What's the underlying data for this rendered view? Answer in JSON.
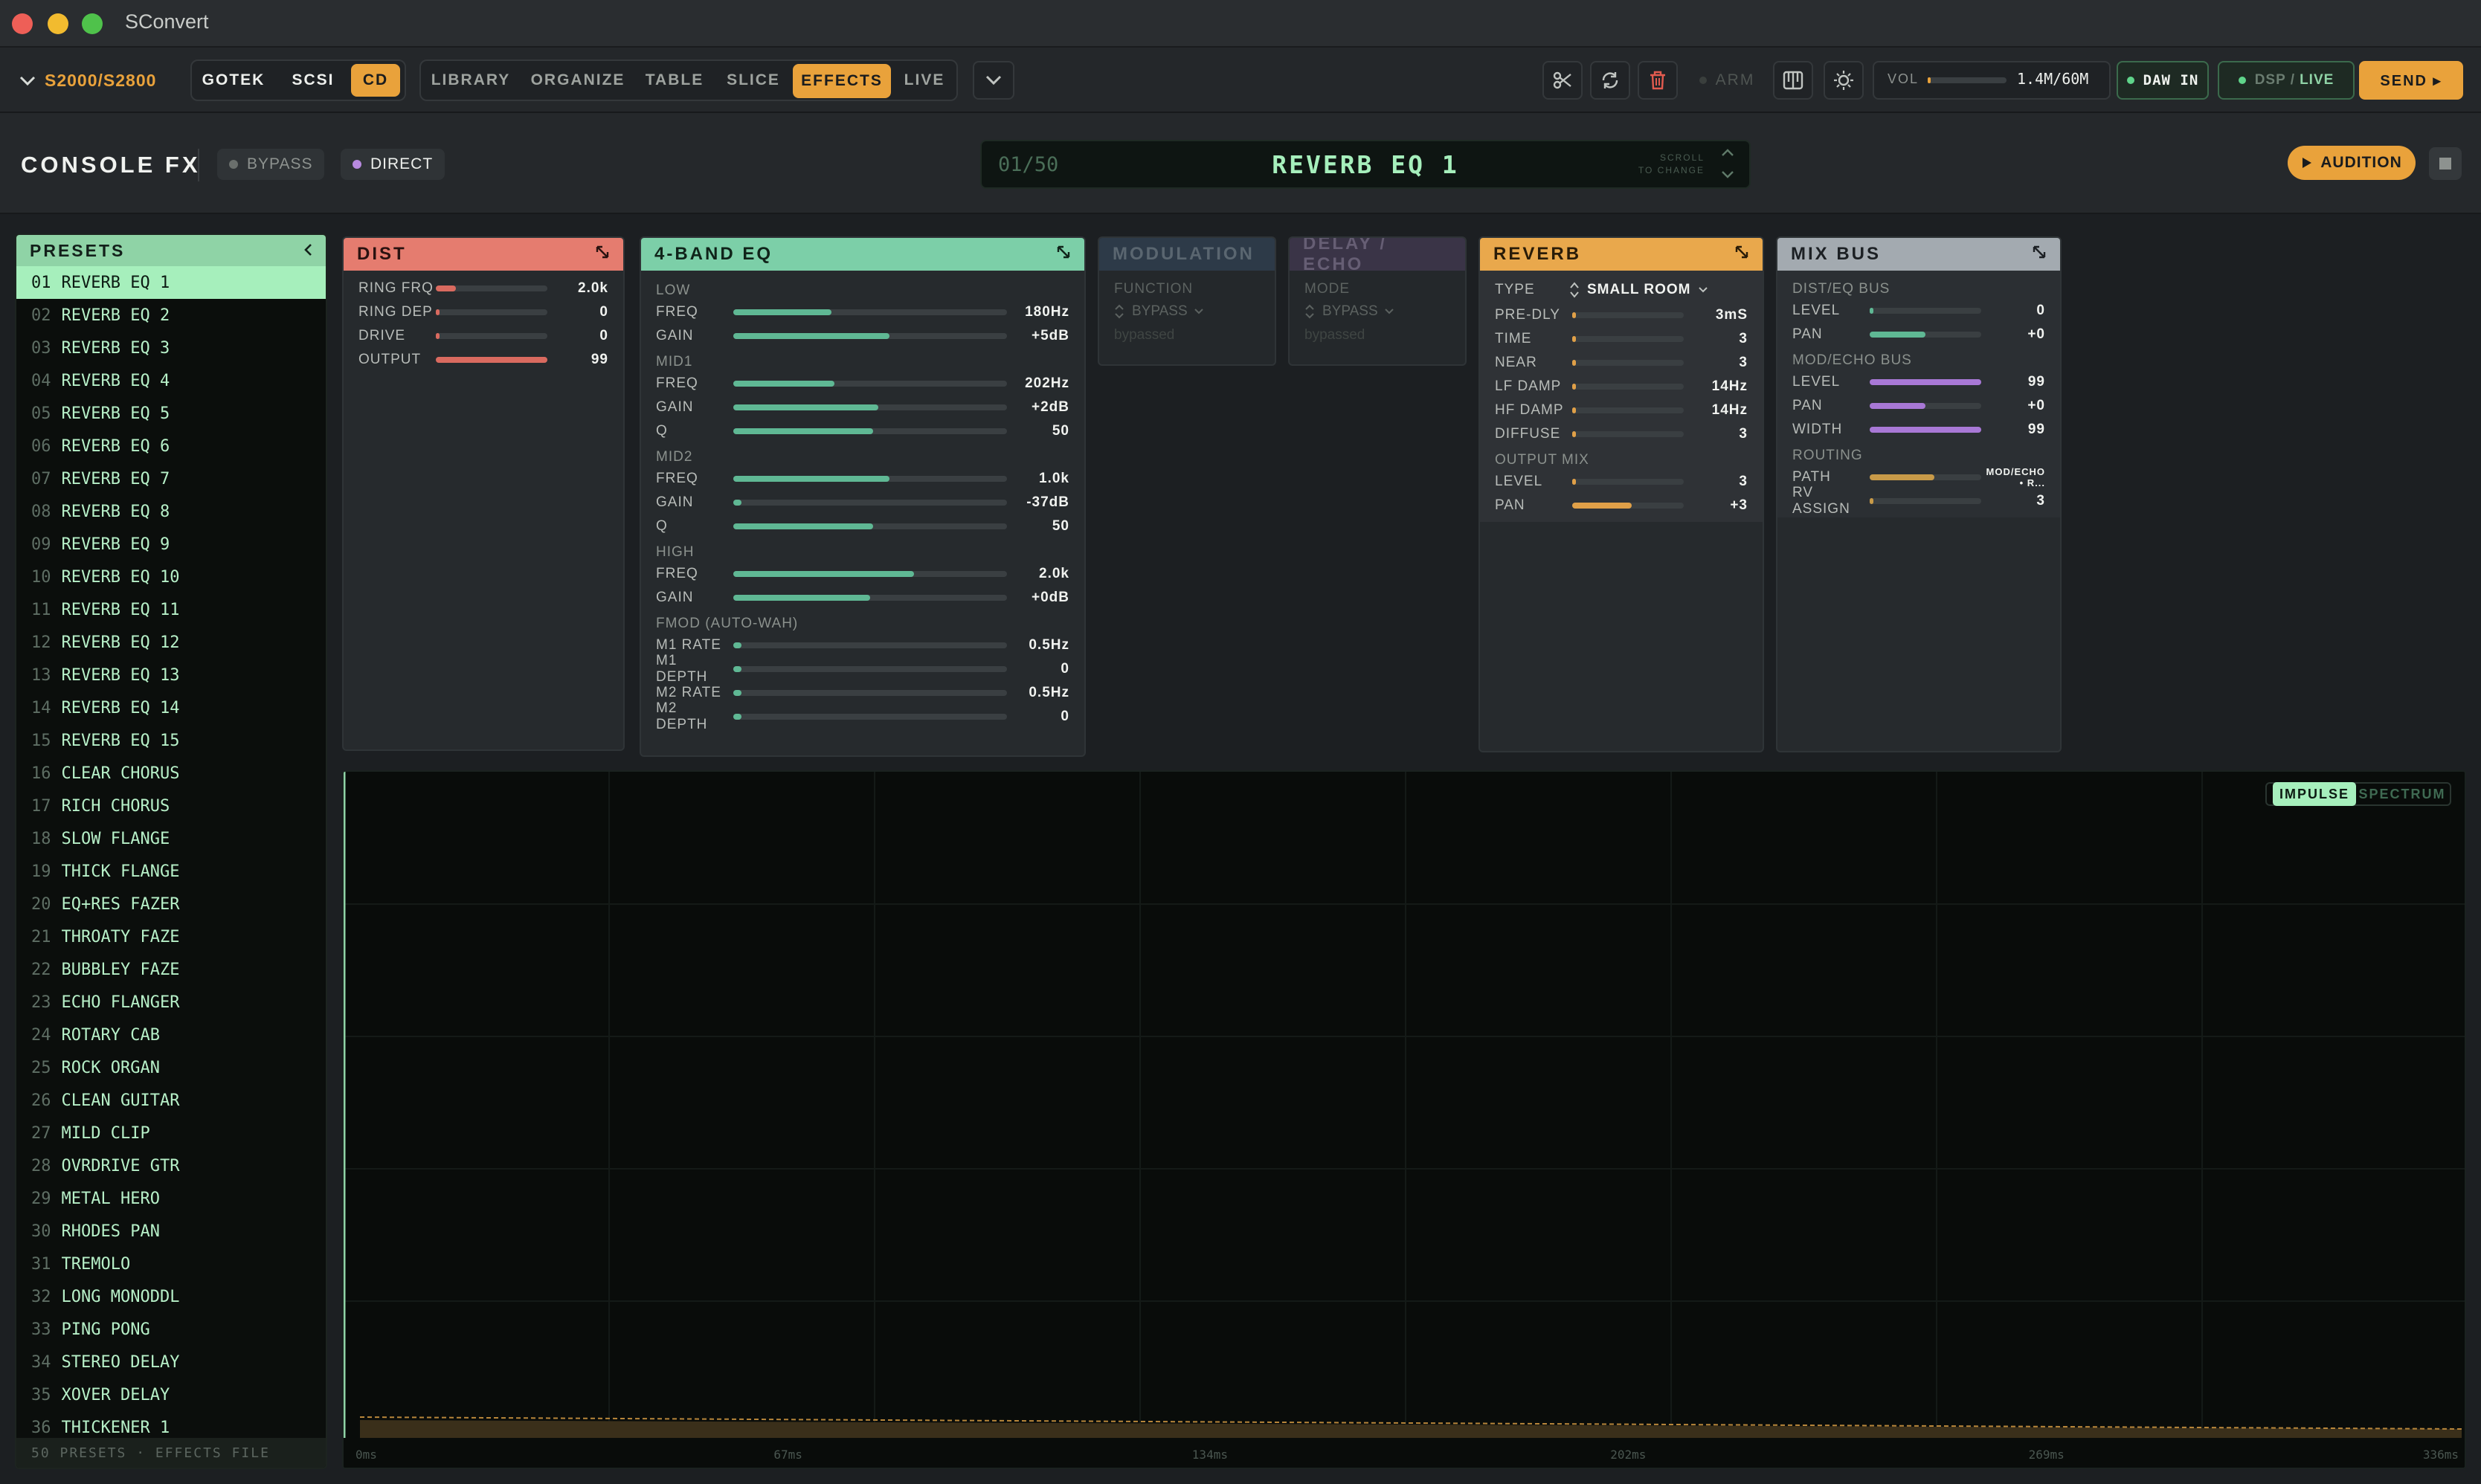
{
  "window": {
    "title": "SConvert"
  },
  "toolbar": {
    "device": "S2000/S2800",
    "media": [
      "GOTEK",
      "SCSI",
      "CD"
    ],
    "media_selected": "CD",
    "tabs": [
      "LIBRARY",
      "ORGANIZE",
      "TABLE",
      "SLICE",
      "EFFECTS",
      "LIVE"
    ],
    "tab_selected": "EFFECTS",
    "arm": "ARM",
    "vol_label": "VOL",
    "vol_level": 0.03,
    "memory": "1.4M/60M",
    "daw_in": "DAW IN",
    "dsp_label": "DSP",
    "live_label": "LIVE",
    "send": "SEND ▸"
  },
  "console": {
    "title": "CONSOLE FX",
    "bypass": "BYPASS",
    "direct": "DIRECT",
    "counter": "01/50",
    "preset_name": "REVERB EQ 1",
    "scroll_hint_1": "SCROLL",
    "scroll_hint_2": "TO CHANGE",
    "audition": "AUDITION"
  },
  "presets": {
    "title": "PRESETS",
    "footer": "50 PRESETS · EFFECTS FILE",
    "selected": 0,
    "items": [
      {
        "n": "01",
        "name": "REVERB EQ 1"
      },
      {
        "n": "02",
        "name": "REVERB EQ 2"
      },
      {
        "n": "03",
        "name": "REVERB EQ 3"
      },
      {
        "n": "04",
        "name": "REVERB EQ 4"
      },
      {
        "n": "05",
        "name": "REVERB EQ 5"
      },
      {
        "n": "06",
        "name": "REVERB EQ 6"
      },
      {
        "n": "07",
        "name": "REVERB EQ 7"
      },
      {
        "n": "08",
        "name": "REVERB EQ 8"
      },
      {
        "n": "09",
        "name": "REVERB EQ 9"
      },
      {
        "n": "10",
        "name": "REVERB EQ 10"
      },
      {
        "n": "11",
        "name": "REVERB EQ 11"
      },
      {
        "n": "12",
        "name": "REVERB EQ 12"
      },
      {
        "n": "13",
        "name": "REVERB EQ 13"
      },
      {
        "n": "14",
        "name": "REVERB EQ 14"
      },
      {
        "n": "15",
        "name": "REVERB EQ 15"
      },
      {
        "n": "16",
        "name": "CLEAR CHORUS"
      },
      {
        "n": "17",
        "name": "RICH CHORUS"
      },
      {
        "n": "18",
        "name": "SLOW FLANGE"
      },
      {
        "n": "19",
        "name": "THICK FLANGE"
      },
      {
        "n": "20",
        "name": "EQ+RES FAZER"
      },
      {
        "n": "21",
        "name": "THROATY FAZE"
      },
      {
        "n": "22",
        "name": "BUBBLEY FAZE"
      },
      {
        "n": "23",
        "name": "ECHO FLANGER"
      },
      {
        "n": "24",
        "name": "ROTARY CAB"
      },
      {
        "n": "25",
        "name": "ROCK ORGAN"
      },
      {
        "n": "26",
        "name": "CLEAN GUITAR"
      },
      {
        "n": "27",
        "name": "MILD CLIP"
      },
      {
        "n": "28",
        "name": "OVRDRIVE GTR"
      },
      {
        "n": "29",
        "name": "METAL HERO"
      },
      {
        "n": "30",
        "name": "RHODES PAN"
      },
      {
        "n": "31",
        "name": "TREMOLO"
      },
      {
        "n": "32",
        "name": "LONG MONODDL"
      },
      {
        "n": "33",
        "name": "PING PONG"
      },
      {
        "n": "34",
        "name": "STEREO DELAY"
      },
      {
        "n": "35",
        "name": "XOVER DELAY"
      },
      {
        "n": "36",
        "name": "THICKENER 1"
      }
    ]
  },
  "dist": {
    "title": "DIST",
    "params": [
      {
        "label": "RING FRQ",
        "value": "2.0k",
        "level": 0.18
      },
      {
        "label": "RING DEP",
        "value": "0",
        "level": 0.03
      },
      {
        "label": "DRIVE",
        "value": "0",
        "level": 0.03
      },
      {
        "label": "OUTPUT",
        "value": "99",
        "level": 1.0
      }
    ]
  },
  "eq": {
    "title": "4-BAND EQ",
    "sections": [
      {
        "name": "LOW",
        "params": [
          {
            "label": "FREQ",
            "value": "180Hz",
            "level": 0.36
          },
          {
            "label": "GAIN",
            "value": "+5dB",
            "level": 0.57
          }
        ]
      },
      {
        "name": "MID1",
        "params": [
          {
            "label": "FREQ",
            "value": "202Hz",
            "level": 0.37
          },
          {
            "label": "GAIN",
            "value": "+2dB",
            "level": 0.53
          },
          {
            "label": "Q",
            "value": "50",
            "level": 0.51
          }
        ]
      },
      {
        "name": "MID2",
        "params": [
          {
            "label": "FREQ",
            "value": "1.0k",
            "level": 0.57
          },
          {
            "label": "GAIN",
            "value": "-37dB",
            "level": 0.02
          },
          {
            "label": "Q",
            "value": "50",
            "level": 0.51
          }
        ]
      },
      {
        "name": "HIGH",
        "params": [
          {
            "label": "FREQ",
            "value": "2.0k",
            "level": 0.66
          },
          {
            "label": "GAIN",
            "value": "+0dB",
            "level": 0.5
          }
        ]
      },
      {
        "name": "FMOD (AUTO-WAH)",
        "params": [
          {
            "label": "M1 RATE",
            "value": "0.5Hz",
            "level": 0.02
          },
          {
            "label": "M1 DEPTH",
            "value": "0",
            "level": 0.02
          },
          {
            "label": "M2 RATE",
            "value": "0.5Hz",
            "level": 0.02
          },
          {
            "label": "M2 DEPTH",
            "value": "0",
            "level": 0.02
          }
        ]
      }
    ]
  },
  "modulation": {
    "title": "MODULATION",
    "field": "FUNCTION",
    "value": "BYPASS",
    "note": "bypassed"
  },
  "delay": {
    "title": "DELAY / ECHO",
    "field": "MODE",
    "value": "BYPASS",
    "note": "bypassed"
  },
  "reverb": {
    "title": "REVERB",
    "type_label": "TYPE",
    "type_value": "SMALL ROOM",
    "params": [
      {
        "label": "PRE-DLY",
        "value": "3mS",
        "level": 0.03
      },
      {
        "label": "TIME",
        "value": "3",
        "level": 0.03
      },
      {
        "label": "NEAR",
        "value": "3",
        "level": 0.03
      },
      {
        "label": "LF DAMP",
        "value": "14Hz",
        "level": 0.03
      },
      {
        "label": "HF DAMP",
        "value": "14Hz",
        "level": 0.03
      },
      {
        "label": "DIFFUSE",
        "value": "3",
        "level": 0.03
      }
    ],
    "output_label": "OUTPUT MIX",
    "output": [
      {
        "label": "LEVEL",
        "value": "3",
        "level": 0.03
      },
      {
        "label": "PAN",
        "value": "+3",
        "level": 0.53
      }
    ]
  },
  "mixbus": {
    "title": "MIX BUS",
    "sections": [
      {
        "name": "DIST/EQ BUS",
        "params": [
          {
            "label": "LEVEL",
            "value": "0",
            "level": 0.02,
            "color": "#5fb894"
          },
          {
            "label": "PAN",
            "value": "+0",
            "level": 0.5,
            "color": "#5fb894"
          }
        ]
      },
      {
        "name": "MOD/ECHO BUS",
        "params": [
          {
            "label": "LEVEL",
            "value": "99",
            "level": 1.0,
            "color": "#a878d6"
          },
          {
            "label": "PAN",
            "value": "+0",
            "level": 0.5,
            "color": "#a878d6"
          },
          {
            "label": "WIDTH",
            "value": "99",
            "level": 1.0,
            "color": "#a878d6"
          }
        ]
      },
      {
        "name": "ROUTING",
        "params": [
          {
            "label": "PATH",
            "value": "MOD/ECHO • R...",
            "level": 0.58,
            "color": "#c89a48"
          },
          {
            "label": "RV ASSIGN",
            "value": "3",
            "level": 0.03,
            "color": "#c89a48"
          }
        ]
      }
    ]
  },
  "graph": {
    "modes": [
      "IMPULSE",
      "SPECTRUM"
    ],
    "mode_selected": "IMPULSE",
    "x_ticks": [
      "0ms",
      "67ms",
      "134ms",
      "202ms",
      "269ms",
      "336ms"
    ]
  },
  "colors": {
    "accent": "#e9a23b",
    "dist": "#e57c6f",
    "eq": "#7ccfa8",
    "reverb": "#e9a84c",
    "mixbus": "#a3aab0",
    "preset_sel": "#a6efbc"
  }
}
